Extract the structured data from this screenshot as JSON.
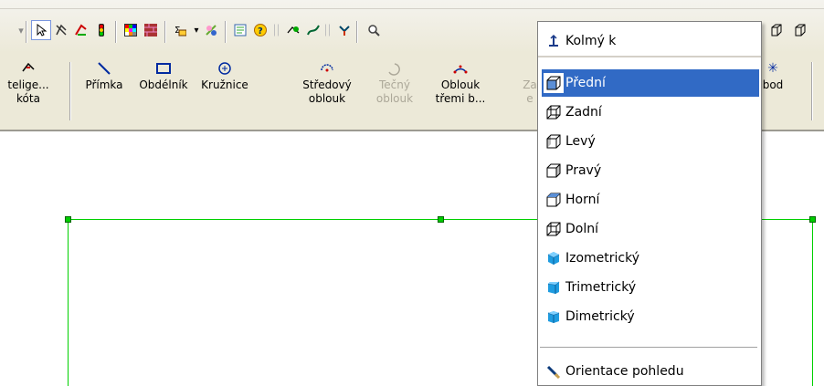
{
  "commands": {
    "smart_dimension": "Inteligentní\nkóta",
    "smart_dimension_visible": "telige...\nkóta",
    "line": "Přímka",
    "rectangle": "Obdélník",
    "circle": "Kružnice",
    "center_arc": "Středový\noblouk",
    "tangent_arc": "Tečný\noblouk",
    "three_point_arc": "Oblouk\ntřemi b...",
    "partial_hidden": "Za\ne",
    "point": "bod"
  },
  "view_menu": {
    "normal_to": "Kolmý k",
    "items": [
      {
        "label": "Přední",
        "icon": "front-view-icon",
        "selected": true
      },
      {
        "label": "Zadní",
        "icon": "back-view-icon"
      },
      {
        "label": "Levý",
        "icon": "left-view-icon"
      },
      {
        "label": "Pravý",
        "icon": "right-view-icon"
      },
      {
        "label": "Horní",
        "icon": "top-view-icon"
      },
      {
        "label": "Dolní",
        "icon": "bottom-view-icon"
      },
      {
        "label": "Izometrický",
        "icon": "isometric-cube-icon"
      },
      {
        "label": "Trimetrický",
        "icon": "trimetric-cube-icon"
      },
      {
        "label": "Dimetrický",
        "icon": "dimetric-cube-icon"
      }
    ],
    "orientation": "Orientace pohledu"
  },
  "colors": {
    "accent": "#316ac5",
    "sketch_green": "#00d000",
    "toolbar_bg": "#ece9d8",
    "disabled_text": "#aca899",
    "cube_blue": "#1f9ce0"
  }
}
